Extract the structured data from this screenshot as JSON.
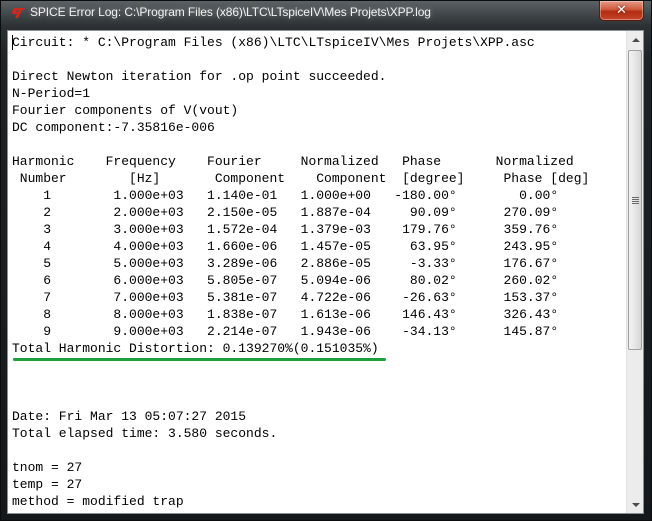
{
  "window": {
    "title": "SPICE Error Log: C:\\Program Files (x86)\\LTC\\LTspiceIV\\Mes Projets\\XPP.log",
    "app_icon": "ltspice-logo-icon",
    "close_icon": "close-icon",
    "close_glyph": "✕"
  },
  "log": {
    "circuit_line": "Circuit: * C:\\Program Files (x86)\\LTC\\LTspiceIV\\Mes Projets\\XPP.asc",
    "op_line": "Direct Newton iteration for .op point succeeded.",
    "nperiod_line": "N-Period=1",
    "fourier_line": "Fourier components of V(vout)",
    "dc_line": "DC component:-7.35816e-006",
    "table": {
      "headers_row1": [
        "Harmonic",
        "Frequency",
        "Fourier",
        "Normalized",
        "Phase",
        "Normalized"
      ],
      "headers_row2": [
        "Number",
        "[Hz]",
        "Component",
        "Component",
        "[degree]",
        "Phase [deg]"
      ],
      "rows": [
        [
          "1",
          "1.000e+03",
          "1.140e-01",
          "1.000e+00",
          "-180.00°",
          "0.00°"
        ],
        [
          "2",
          "2.000e+03",
          "2.150e-05",
          "1.887e-04",
          "90.09°",
          "270.09°"
        ],
        [
          "3",
          "3.000e+03",
          "1.572e-04",
          "1.379e-03",
          "179.76°",
          "359.76°"
        ],
        [
          "4",
          "4.000e+03",
          "1.660e-06",
          "1.457e-05",
          "63.95°",
          "243.95°"
        ],
        [
          "5",
          "5.000e+03",
          "3.289e-06",
          "2.886e-05",
          "-3.33°",
          "176.67°"
        ],
        [
          "6",
          "6.000e+03",
          "5.805e-07",
          "5.094e-06",
          "80.02°",
          "260.02°"
        ],
        [
          "7",
          "7.000e+03",
          "5.381e-07",
          "4.722e-06",
          "-26.63°",
          "153.37°"
        ],
        [
          "8",
          "8.000e+03",
          "1.838e-07",
          "1.613e-06",
          "146.43°",
          "326.43°"
        ],
        [
          "9",
          "9.000e+03",
          "2.214e-07",
          "1.943e-06",
          "-34.13°",
          "145.87°"
        ]
      ]
    },
    "thd_line": "Total Harmonic Distortion: 0.139270%(0.151035%)",
    "highlight_color": "#1f9e3e",
    "date_line": "Date: Fri Mar 13 05:07:27 2015",
    "elapsed_line": "Total elapsed time: 3.580 seconds.",
    "tnom_line": "tnom = 27",
    "temp_line": "temp = 27",
    "method_line": "method = modified trap"
  },
  "scrollbar": {
    "up_icon": "scroll-up-arrow-icon",
    "down_icon": "scroll-down-arrow-icon",
    "position_fraction": 0.0,
    "visible_fraction": 0.67
  }
}
